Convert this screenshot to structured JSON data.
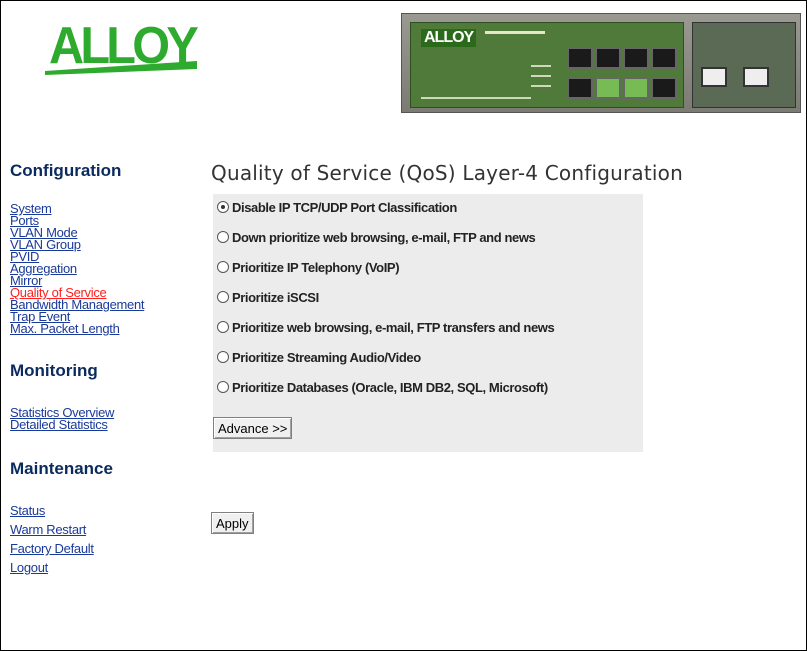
{
  "brand": {
    "logo_text": "ALLOY",
    "logo_color": "#2eaa2e"
  },
  "device": {
    "logo_text": "ALLOY"
  },
  "sidebar": {
    "configuration": {
      "title": "Configuration",
      "links": [
        {
          "label": "System",
          "active": false
        },
        {
          "label": "Ports",
          "active": false
        },
        {
          "label": "VLAN Mode",
          "active": false
        },
        {
          "label": "VLAN Group",
          "active": false
        },
        {
          "label": "PVID",
          "active": false
        },
        {
          "label": "Aggregation",
          "active": false
        },
        {
          "label": "Mirror",
          "active": false
        },
        {
          "label": "Quality of Service",
          "active": true
        },
        {
          "label": "Bandwidth Management",
          "active": false
        },
        {
          "label": "Trap Event",
          "active": false
        },
        {
          "label": "Max. Packet Length",
          "active": false
        }
      ]
    },
    "monitoring": {
      "title": "Monitoring",
      "links": [
        {
          "label": "Statistics Overview"
        },
        {
          "label": "Detailed Statistics"
        }
      ]
    },
    "maintenance": {
      "title": "Maintenance",
      "links": [
        {
          "label": "Status"
        },
        {
          "label": "Warm Restart"
        },
        {
          "label": "Factory Default"
        },
        {
          "label": "Logout"
        }
      ]
    }
  },
  "main": {
    "title": "Quality of Service (QoS) Layer-4 Configuration",
    "options": [
      {
        "label": "Disable IP TCP/UDP Port Classification",
        "checked": true
      },
      {
        "label": "Down prioritize web browsing, e-mail, FTP and news",
        "checked": false
      },
      {
        "label": "Prioritize IP Telephony (VoIP)",
        "checked": false
      },
      {
        "label": "Prioritize iSCSI",
        "checked": false
      },
      {
        "label": "Prioritize web browsing, e-mail, FTP transfers and news",
        "checked": false
      },
      {
        "label": "Prioritize Streaming Audio/Video",
        "checked": false
      },
      {
        "label": "Prioritize Databases (Oracle, IBM DB2, SQL, Microsoft)",
        "checked": false
      }
    ],
    "advance_button": "Advance >>",
    "apply_button": "Apply"
  },
  "colors": {
    "link": "#1a3a9a",
    "active_link": "#ff2020",
    "section_title": "#0b2a5e",
    "option_bg": "#ececec"
  }
}
